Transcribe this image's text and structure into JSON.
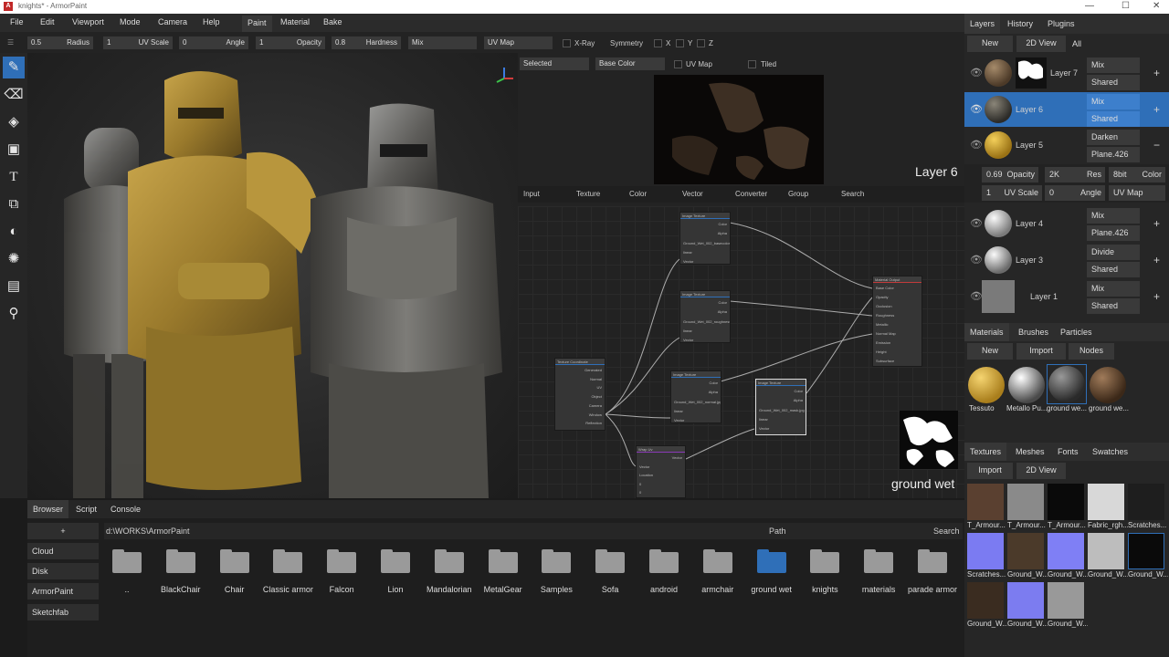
{
  "window": {
    "title": "knights* - ArmorPaint",
    "logo": "A"
  },
  "menu": {
    "file": "File",
    "edit": "Edit",
    "viewport": "Viewport",
    "mode": "Mode",
    "camera": "Camera",
    "help": "Help",
    "paint": "Paint",
    "material": "Material",
    "bake": "Bake"
  },
  "toolopts": {
    "radius_val": "0.5",
    "radius": "Radius",
    "uvscale_val": "1",
    "uvscale": "UV Scale",
    "angle_val": "0",
    "angle": "Angle",
    "opacity_val": "1",
    "opacity": "Opacity",
    "hardness_val": "0.8",
    "hardness": "Hardness",
    "blend": "Mix",
    "uvmap": "UV Map",
    "xray": "X-Ray",
    "symmetry": "Symmetry",
    "x": "X",
    "y": "Y",
    "z": "Z"
  },
  "nodebar": {
    "selected": "Selected",
    "base_color": "Base Color",
    "uvmap": "UV Map",
    "tiled": "Tiled",
    "layer_label": "Layer 6"
  },
  "nodemenu": {
    "input": "Input",
    "texture": "Texture",
    "color": "Color",
    "vector": "Vector",
    "converter": "Converter",
    "group": "Group",
    "search": "Search"
  },
  "nodes": {
    "tc": {
      "title": "Texture Coordinate",
      "rows": [
        "Generated",
        "Normal",
        "UV",
        "Object",
        "Camera",
        "Window",
        "Reflection"
      ]
    },
    "it1": {
      "title": "Image Texture",
      "rows": [
        "Color",
        "Alpha",
        "Ground_Wet_002_basecolor.jpg",
        "linear",
        "Vector"
      ]
    },
    "it2": {
      "title": "Image Texture",
      "rows": [
        "Color",
        "Alpha",
        "Ground_Wet_002_roughness.jpg",
        "linear",
        "Vector"
      ]
    },
    "it3": {
      "title": "Image Texture",
      "rows": [
        "Color",
        "Alpha",
        "Ground_Wet_002_normal.jpg",
        "linear",
        "Vector"
      ]
    },
    "it4": {
      "title": "Image Texture",
      "rows": [
        "Color",
        "Alpha",
        "Ground_Wet_002_mask.jpg",
        "linear",
        "Vector"
      ]
    },
    "wm": {
      "title": "Wrap Uv",
      "rows": [
        "Vector",
        "Vector",
        "Location",
        "0",
        "0"
      ]
    },
    "mo": {
      "title": "Material Output",
      "rows": [
        "Base Color",
        "Opacity",
        "Occlusion",
        "Roughness",
        "Metallic",
        "Normal Map",
        "Emission",
        "Height",
        "Subsurface"
      ]
    }
  },
  "preview": {
    "label": "ground wet"
  },
  "right": {
    "tabs": {
      "layers": "Layers",
      "history": "History",
      "plugins": "Plugins"
    },
    "btns": {
      "new": "New",
      "view2d": "2D View",
      "all": "All"
    },
    "layers": [
      {
        "name": "Layer 7",
        "blend": "Mix",
        "mode": "Shared",
        "action": "+"
      },
      {
        "name": "Layer 6",
        "blend": "Mix",
        "mode": "Shared",
        "action": "+"
      },
      {
        "name": "Layer 5",
        "blend": "Darken",
        "mode": "Plane.426",
        "action": "−"
      },
      {
        "name": "Layer 4",
        "blend": "Mix",
        "mode": "Plane.426",
        "action": "+"
      },
      {
        "name": "Layer 3",
        "blend": "Divide",
        "mode": "Shared",
        "action": "+"
      },
      {
        "name": "Layer 1",
        "blend": "Mix",
        "mode": "Shared",
        "action": "+"
      }
    ],
    "props": {
      "opacity_val": "0.69",
      "opacity": "Opacity",
      "res_val": "2K",
      "res": "Res",
      "bit_val": "8bit",
      "color": "Color",
      "uvscale_val": "1",
      "uvscale": "UV Scale",
      "angle_val": "0",
      "angle": "Angle",
      "uvmap": "UV Map"
    },
    "mtabs": {
      "materials": "Materials",
      "brushes": "Brushes",
      "particles": "Particles"
    },
    "mbtns": {
      "new": "New",
      "import": "Import",
      "nodes": "Nodes"
    },
    "materials": [
      "Tessuto",
      "Metallo Pu...",
      "ground we...",
      "ground we..."
    ],
    "ttabs": {
      "textures": "Textures",
      "meshes": "Meshes",
      "fonts": "Fonts",
      "swatches": "Swatches"
    },
    "tbtns": {
      "import": "Import",
      "view2d": "2D View"
    },
    "textures": [
      "T_Armour...",
      "T_Armour...",
      "T_Armour...",
      "Fabric_rgh...",
      "Scratches...",
      "Scratches...",
      "Ground_W...",
      "Ground_W...",
      "Ground_W...",
      "Ground_W...",
      "Ground_W...",
      "Ground_W...",
      "Ground_W..."
    ]
  },
  "bottom": {
    "tabs": {
      "browser": "Browser",
      "script": "Script",
      "console": "Console"
    },
    "add": "+",
    "path": "d:\\WORKS\\ArmorPaint",
    "path_label": "Path",
    "search": "Search",
    "sidebar": [
      "Cloud",
      "Disk",
      "ArmorPaint",
      "Sketchfab"
    ],
    "folders": [
      "..",
      "BlackChair",
      "Chair",
      "Classic armor",
      "Falcon",
      "Lion",
      "Mandalorian",
      "MetalGear",
      "Samples",
      "Sofa",
      "android",
      "armchair",
      "ground wet",
      "knights",
      "materials",
      "parade armor"
    ]
  },
  "colors": {
    "accent": "#2f6fb8",
    "bg": "#1b1b1b"
  }
}
